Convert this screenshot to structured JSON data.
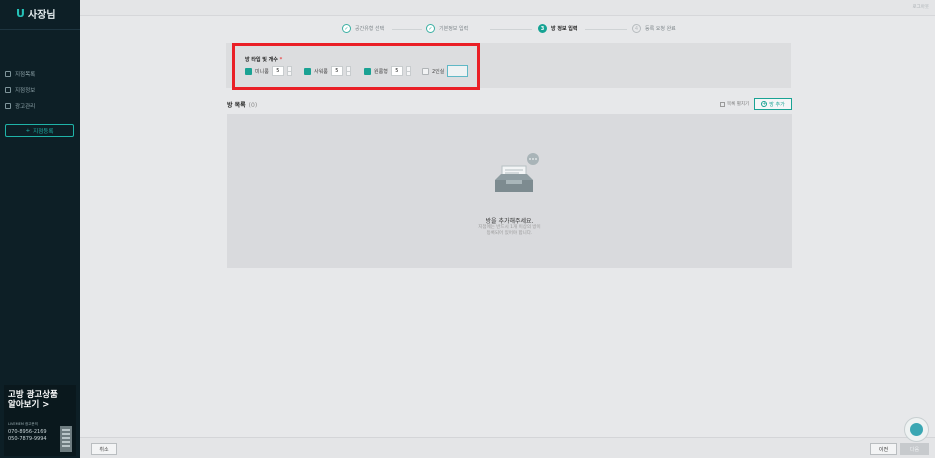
{
  "app": {
    "logo_mark": "U",
    "logo_text": "사장님"
  },
  "sidebar": {
    "items": [
      {
        "label": "지점목록",
        "icon": "list-icon"
      },
      {
        "label": "지점정보",
        "icon": "info-icon"
      },
      {
        "label": "광고관리",
        "icon": "megaphone-icon"
      }
    ],
    "add_button": "지점등록"
  },
  "promo": {
    "title_line1": "고방 광고상품",
    "title_line2": "알아보기",
    "arrow": ">",
    "subtitle": "LIVEMEM 광고문의",
    "phone1": "070-8956-2169",
    "phone2": "050-7879-9994"
  },
  "topbar": {
    "right_text": "로그아웃"
  },
  "stepper": {
    "steps": [
      {
        "label": "공간유형 선택",
        "status": "done",
        "marker": "✓"
      },
      {
        "label": "기본정보 입력",
        "status": "done",
        "marker": "✓"
      },
      {
        "label": "방 정보 입력",
        "status": "active",
        "marker": "3"
      },
      {
        "label": "등록 요청 완료",
        "status": "todo",
        "marker": "4"
      }
    ]
  },
  "room_type": {
    "title": "방 타입 및 개수",
    "required_mark": "*",
    "types": [
      {
        "label": "미니룸",
        "checked": true,
        "count": "5"
      },
      {
        "label": "사워룸",
        "checked": true,
        "count": "5"
      },
      {
        "label": "원룸형",
        "checked": true,
        "count": "5"
      },
      {
        "label": "2인실",
        "checked": false,
        "count": ""
      }
    ]
  },
  "room_list": {
    "title": "방 목록",
    "count": "(0)",
    "fold_label": "목록 펼치기",
    "add_button": "방 추가",
    "empty_main": "방을 추가해주세요.",
    "empty_sub1": "지점에는 반드시 1개 이상의 방이",
    "empty_sub2": "등록되어 있어야 합니다."
  },
  "footer": {
    "cancel": "취소",
    "prev": "이전",
    "next": "다음"
  },
  "colors": {
    "accent": "#16a394",
    "highlight": "#ea1f26",
    "sidebar": "#0d1f26"
  }
}
